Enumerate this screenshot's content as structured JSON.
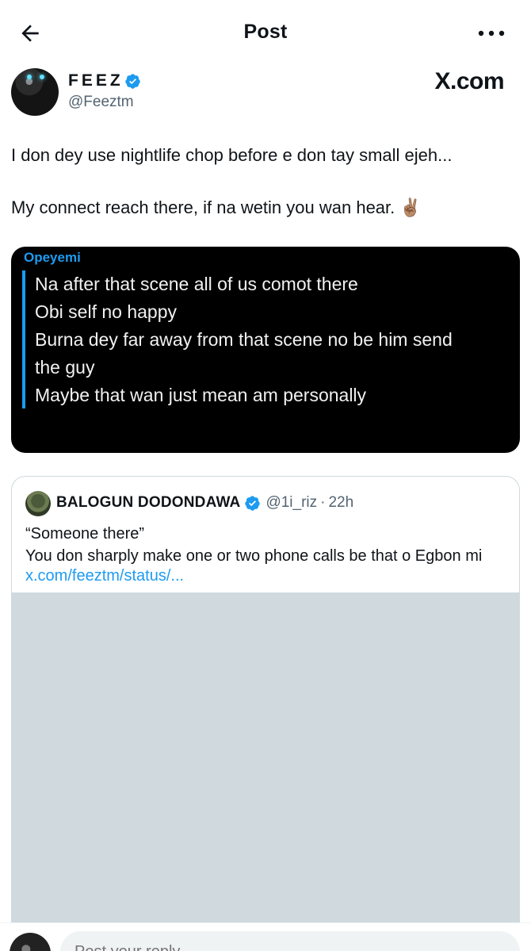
{
  "header": {
    "title": "Post",
    "back_icon": "arrow-left-icon",
    "more_icon": "more-horizontal-icon"
  },
  "author": {
    "display_name": "FEEZ",
    "handle": "@Feeztm",
    "verified": true,
    "source_badge": "X.com"
  },
  "post": {
    "line1": "I don dey use nightlife chop before e don tay small ejeh...",
    "line2": "My connect reach there, if na wetin you wan hear. ✌🏽"
  },
  "media": {
    "author": "Opeyemi",
    "lines": [
      "Na after that scene all of us comot there",
      "Obi self no happy",
      "Burna dey far away from that scene no be him send",
      "the guy",
      "Maybe that wan just mean am personally"
    ]
  },
  "quote": {
    "name": "BALOGUN DODONDAWA",
    "handle": "@1i_riz",
    "dot": "·",
    "time": "22h",
    "text_line1": "“Someone there”",
    "text_line2": "You don sharply make one or two phone calls be that o Egbon mi",
    "link": "x.com/feeztm/status/..."
  },
  "reply": {
    "placeholder": "Post your reply"
  },
  "colors": {
    "accent": "#1d9bf0",
    "text": "#0f1419",
    "secondary": "#536471",
    "media_placeholder": "#cfd9de"
  }
}
